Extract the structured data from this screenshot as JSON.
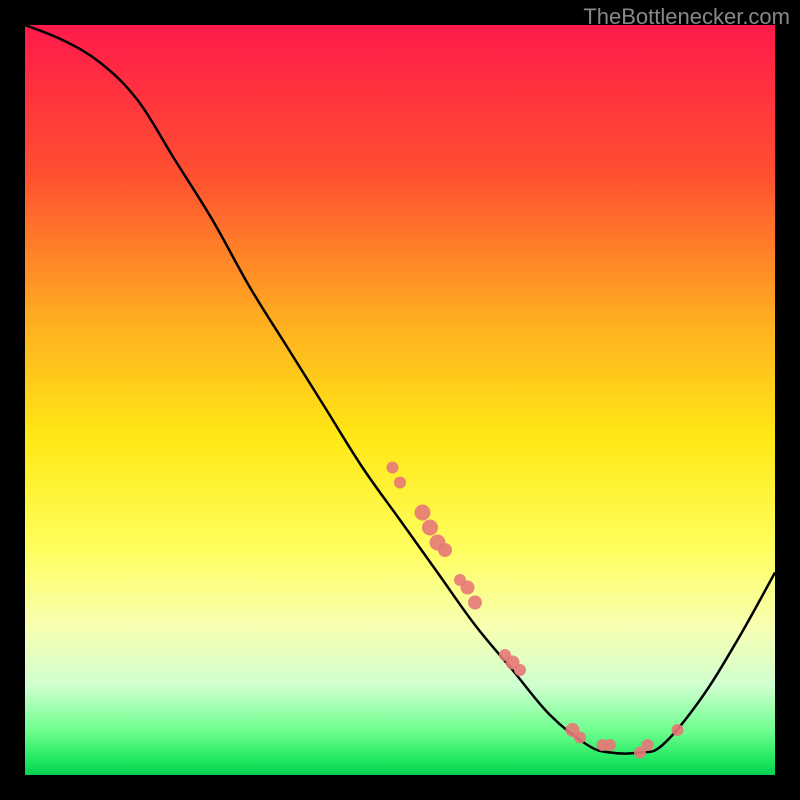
{
  "watermark": "TheBottlenecker.com",
  "chart_data": {
    "type": "line",
    "title": "",
    "xlabel": "",
    "ylabel": "",
    "xlim": [
      0,
      100
    ],
    "ylim": [
      0,
      100
    ],
    "gradient_stops": [
      {
        "offset": 0,
        "color": "#ff1a4a"
      },
      {
        "offset": 20,
        "color": "#ff5030"
      },
      {
        "offset": 40,
        "color": "#ffb020"
      },
      {
        "offset": 55,
        "color": "#ffe815"
      },
      {
        "offset": 70,
        "color": "#ffff60"
      },
      {
        "offset": 80,
        "color": "#f8ffb0"
      },
      {
        "offset": 88,
        "color": "#d0ffd0"
      },
      {
        "offset": 94,
        "color": "#70ff90"
      },
      {
        "offset": 98,
        "color": "#20e860"
      },
      {
        "offset": 100,
        "color": "#00d050"
      }
    ],
    "curve": [
      {
        "x": 0,
        "y": 100
      },
      {
        "x": 5,
        "y": 98
      },
      {
        "x": 10,
        "y": 95
      },
      {
        "x": 15,
        "y": 90
      },
      {
        "x": 20,
        "y": 82
      },
      {
        "x": 25,
        "y": 74
      },
      {
        "x": 30,
        "y": 65
      },
      {
        "x": 35,
        "y": 57
      },
      {
        "x": 40,
        "y": 49
      },
      {
        "x": 45,
        "y": 41
      },
      {
        "x": 50,
        "y": 34
      },
      {
        "x": 55,
        "y": 27
      },
      {
        "x": 60,
        "y": 20
      },
      {
        "x": 65,
        "y": 14
      },
      {
        "x": 70,
        "y": 8
      },
      {
        "x": 75,
        "y": 4
      },
      {
        "x": 78,
        "y": 3
      },
      {
        "x": 82,
        "y": 3
      },
      {
        "x": 85,
        "y": 4
      },
      {
        "x": 90,
        "y": 10
      },
      {
        "x": 95,
        "y": 18
      },
      {
        "x": 100,
        "y": 27
      }
    ],
    "dots": [
      {
        "x": 49,
        "y": 41,
        "r": 6
      },
      {
        "x": 50,
        "y": 39,
        "r": 6
      },
      {
        "x": 53,
        "y": 35,
        "r": 8
      },
      {
        "x": 54,
        "y": 33,
        "r": 8
      },
      {
        "x": 55,
        "y": 31,
        "r": 8
      },
      {
        "x": 56,
        "y": 30,
        "r": 7
      },
      {
        "x": 58,
        "y": 26,
        "r": 6
      },
      {
        "x": 59,
        "y": 25,
        "r": 7
      },
      {
        "x": 60,
        "y": 23,
        "r": 7
      },
      {
        "x": 64,
        "y": 16,
        "r": 6
      },
      {
        "x": 65,
        "y": 15,
        "r": 7
      },
      {
        "x": 66,
        "y": 14,
        "r": 6
      },
      {
        "x": 73,
        "y": 6,
        "r": 7
      },
      {
        "x": 74,
        "y": 5,
        "r": 6
      },
      {
        "x": 77,
        "y": 4,
        "r": 6
      },
      {
        "x": 78,
        "y": 4,
        "r": 6
      },
      {
        "x": 82,
        "y": 3,
        "r": 6
      },
      {
        "x": 83,
        "y": 4,
        "r": 6
      },
      {
        "x": 87,
        "y": 6,
        "r": 6
      }
    ],
    "dot_color": "#e77878"
  }
}
